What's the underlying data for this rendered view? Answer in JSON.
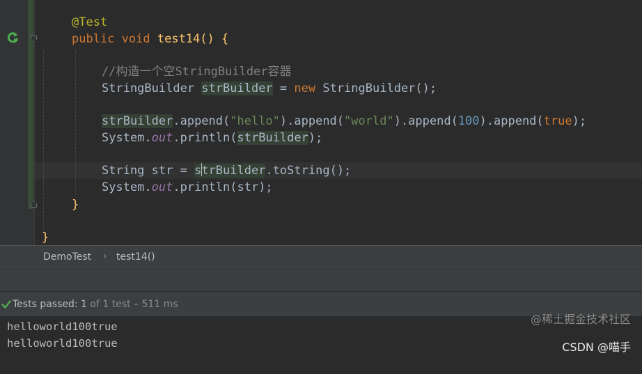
{
  "editor": {
    "lines": {
      "annotation": "@Test",
      "signature": {
        "kw_public": "public",
        "kw_void": "void",
        "method": "test14",
        "parens": "()",
        "brace": "{"
      },
      "comment": "//构造一个空StringBuilder容器",
      "decl": {
        "type": "StringBuilder",
        "var": "strBuilder",
        "assign": " = ",
        "kw_new": "new",
        "ctor": "StringBuilder",
        "end": "();"
      },
      "append": {
        "var": "strBuilder",
        "m1": ".append(",
        "s1": "\"hello\"",
        "m2": ").append(",
        "s2": "\"world\"",
        "m3": ").append(",
        "n1": "100",
        "m4": ").append(",
        "b1": "true",
        "end": ");"
      },
      "print1": {
        "sys": "System.",
        "out": "out",
        "call": ".println(",
        "arg": "strBuilder",
        "end": ");"
      },
      "tostring": {
        "type": "String",
        "var": " str = ",
        "recv_a": "s",
        "recv_b": "trBuilder",
        "call": ".toString",
        "end": "();"
      },
      "print2": {
        "sys": "System.",
        "out": "out",
        "call": ".println(str);"
      },
      "close_method": "}",
      "close_class": "}"
    }
  },
  "breadcrumb": {
    "class_name": "DemoTest",
    "separator": "›",
    "method_name": "test14()"
  },
  "test_status": {
    "label": "Tests passed: ",
    "count": "1",
    "rest": " of 1 test – 511 ms"
  },
  "console": {
    "output": [
      "helloworld100true",
      "helloworld100true"
    ]
  },
  "watermark": {
    "line1": "@稀土掘金技术社区",
    "line2": "CSDN @喵手"
  },
  "icons": {
    "run": "run-test-icon",
    "check": "check-icon",
    "fold": "fold-icon"
  },
  "colors": {
    "keyword": "#cc7832",
    "method": "#ffc66d",
    "string": "#6a8759",
    "number": "#6897bb",
    "annotation": "#bbb529",
    "static_field": "#9876aa",
    "comment": "#808080",
    "pass": "#4caf50"
  }
}
